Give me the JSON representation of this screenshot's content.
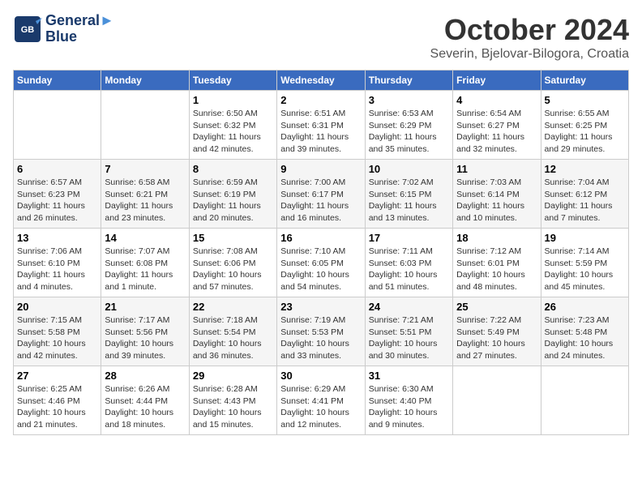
{
  "header": {
    "logo_line1": "General",
    "logo_line2": "Blue",
    "month": "October 2024",
    "location": "Severin, Bjelovar-Bilogora, Croatia"
  },
  "days_of_week": [
    "Sunday",
    "Monday",
    "Tuesday",
    "Wednesday",
    "Thursday",
    "Friday",
    "Saturday"
  ],
  "weeks": [
    [
      {
        "day": "",
        "info": ""
      },
      {
        "day": "",
        "info": ""
      },
      {
        "day": "1",
        "info": "Sunrise: 6:50 AM\nSunset: 6:32 PM\nDaylight: 11 hours and 42 minutes."
      },
      {
        "day": "2",
        "info": "Sunrise: 6:51 AM\nSunset: 6:31 PM\nDaylight: 11 hours and 39 minutes."
      },
      {
        "day": "3",
        "info": "Sunrise: 6:53 AM\nSunset: 6:29 PM\nDaylight: 11 hours and 35 minutes."
      },
      {
        "day": "4",
        "info": "Sunrise: 6:54 AM\nSunset: 6:27 PM\nDaylight: 11 hours and 32 minutes."
      },
      {
        "day": "5",
        "info": "Sunrise: 6:55 AM\nSunset: 6:25 PM\nDaylight: 11 hours and 29 minutes."
      }
    ],
    [
      {
        "day": "6",
        "info": "Sunrise: 6:57 AM\nSunset: 6:23 PM\nDaylight: 11 hours and 26 minutes."
      },
      {
        "day": "7",
        "info": "Sunrise: 6:58 AM\nSunset: 6:21 PM\nDaylight: 11 hours and 23 minutes."
      },
      {
        "day": "8",
        "info": "Sunrise: 6:59 AM\nSunset: 6:19 PM\nDaylight: 11 hours and 20 minutes."
      },
      {
        "day": "9",
        "info": "Sunrise: 7:00 AM\nSunset: 6:17 PM\nDaylight: 11 hours and 16 minutes."
      },
      {
        "day": "10",
        "info": "Sunrise: 7:02 AM\nSunset: 6:15 PM\nDaylight: 11 hours and 13 minutes."
      },
      {
        "day": "11",
        "info": "Sunrise: 7:03 AM\nSunset: 6:14 PM\nDaylight: 11 hours and 10 minutes."
      },
      {
        "day": "12",
        "info": "Sunrise: 7:04 AM\nSunset: 6:12 PM\nDaylight: 11 hours and 7 minutes."
      }
    ],
    [
      {
        "day": "13",
        "info": "Sunrise: 7:06 AM\nSunset: 6:10 PM\nDaylight: 11 hours and 4 minutes."
      },
      {
        "day": "14",
        "info": "Sunrise: 7:07 AM\nSunset: 6:08 PM\nDaylight: 11 hours and 1 minute."
      },
      {
        "day": "15",
        "info": "Sunrise: 7:08 AM\nSunset: 6:06 PM\nDaylight: 10 hours and 57 minutes."
      },
      {
        "day": "16",
        "info": "Sunrise: 7:10 AM\nSunset: 6:05 PM\nDaylight: 10 hours and 54 minutes."
      },
      {
        "day": "17",
        "info": "Sunrise: 7:11 AM\nSunset: 6:03 PM\nDaylight: 10 hours and 51 minutes."
      },
      {
        "day": "18",
        "info": "Sunrise: 7:12 AM\nSunset: 6:01 PM\nDaylight: 10 hours and 48 minutes."
      },
      {
        "day": "19",
        "info": "Sunrise: 7:14 AM\nSunset: 5:59 PM\nDaylight: 10 hours and 45 minutes."
      }
    ],
    [
      {
        "day": "20",
        "info": "Sunrise: 7:15 AM\nSunset: 5:58 PM\nDaylight: 10 hours and 42 minutes."
      },
      {
        "day": "21",
        "info": "Sunrise: 7:17 AM\nSunset: 5:56 PM\nDaylight: 10 hours and 39 minutes."
      },
      {
        "day": "22",
        "info": "Sunrise: 7:18 AM\nSunset: 5:54 PM\nDaylight: 10 hours and 36 minutes."
      },
      {
        "day": "23",
        "info": "Sunrise: 7:19 AM\nSunset: 5:53 PM\nDaylight: 10 hours and 33 minutes."
      },
      {
        "day": "24",
        "info": "Sunrise: 7:21 AM\nSunset: 5:51 PM\nDaylight: 10 hours and 30 minutes."
      },
      {
        "day": "25",
        "info": "Sunrise: 7:22 AM\nSunset: 5:49 PM\nDaylight: 10 hours and 27 minutes."
      },
      {
        "day": "26",
        "info": "Sunrise: 7:23 AM\nSunset: 5:48 PM\nDaylight: 10 hours and 24 minutes."
      }
    ],
    [
      {
        "day": "27",
        "info": "Sunrise: 6:25 AM\nSunset: 4:46 PM\nDaylight: 10 hours and 21 minutes."
      },
      {
        "day": "28",
        "info": "Sunrise: 6:26 AM\nSunset: 4:44 PM\nDaylight: 10 hours and 18 minutes."
      },
      {
        "day": "29",
        "info": "Sunrise: 6:28 AM\nSunset: 4:43 PM\nDaylight: 10 hours and 15 minutes."
      },
      {
        "day": "30",
        "info": "Sunrise: 6:29 AM\nSunset: 4:41 PM\nDaylight: 10 hours and 12 minutes."
      },
      {
        "day": "31",
        "info": "Sunrise: 6:30 AM\nSunset: 4:40 PM\nDaylight: 10 hours and 9 minutes."
      },
      {
        "day": "",
        "info": ""
      },
      {
        "day": "",
        "info": ""
      }
    ]
  ]
}
